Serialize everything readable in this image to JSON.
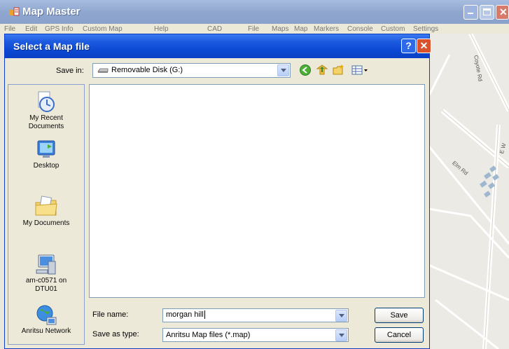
{
  "app": {
    "title": "Map Master",
    "menu": [
      "File",
      "Edit",
      "GPS Info",
      "Custom Map",
      "Help",
      "CAD",
      "File",
      "Maps",
      "Map",
      "Markers",
      "Console",
      "Custom",
      "Settings"
    ]
  },
  "map": {
    "streets": [
      "Coyote Rd",
      "Elm Rd",
      "E W"
    ]
  },
  "dialog": {
    "title": "Select a Map file",
    "help_label": "?",
    "close_label": "✕",
    "save_in_label": "Save in:",
    "save_in_value": "Removable Disk (G:)",
    "places": [
      {
        "label": "My Recent Documents",
        "icon": "recent-documents-icon"
      },
      {
        "label": "Desktop",
        "icon": "desktop-icon"
      },
      {
        "label": "My Documents",
        "icon": "my-documents-icon"
      },
      {
        "label": "am-c0571 on DTU01",
        "icon": "my-computer-icon"
      },
      {
        "label": "Anritsu Network",
        "icon": "network-icon"
      }
    ],
    "file_name_label": "File name:",
    "file_name_value": "morgan hill",
    "save_as_type_label": "Save as type:",
    "save_as_type_value": "Anritsu Map files (*.map)",
    "save_button": "Save",
    "cancel_button": "Cancel"
  }
}
